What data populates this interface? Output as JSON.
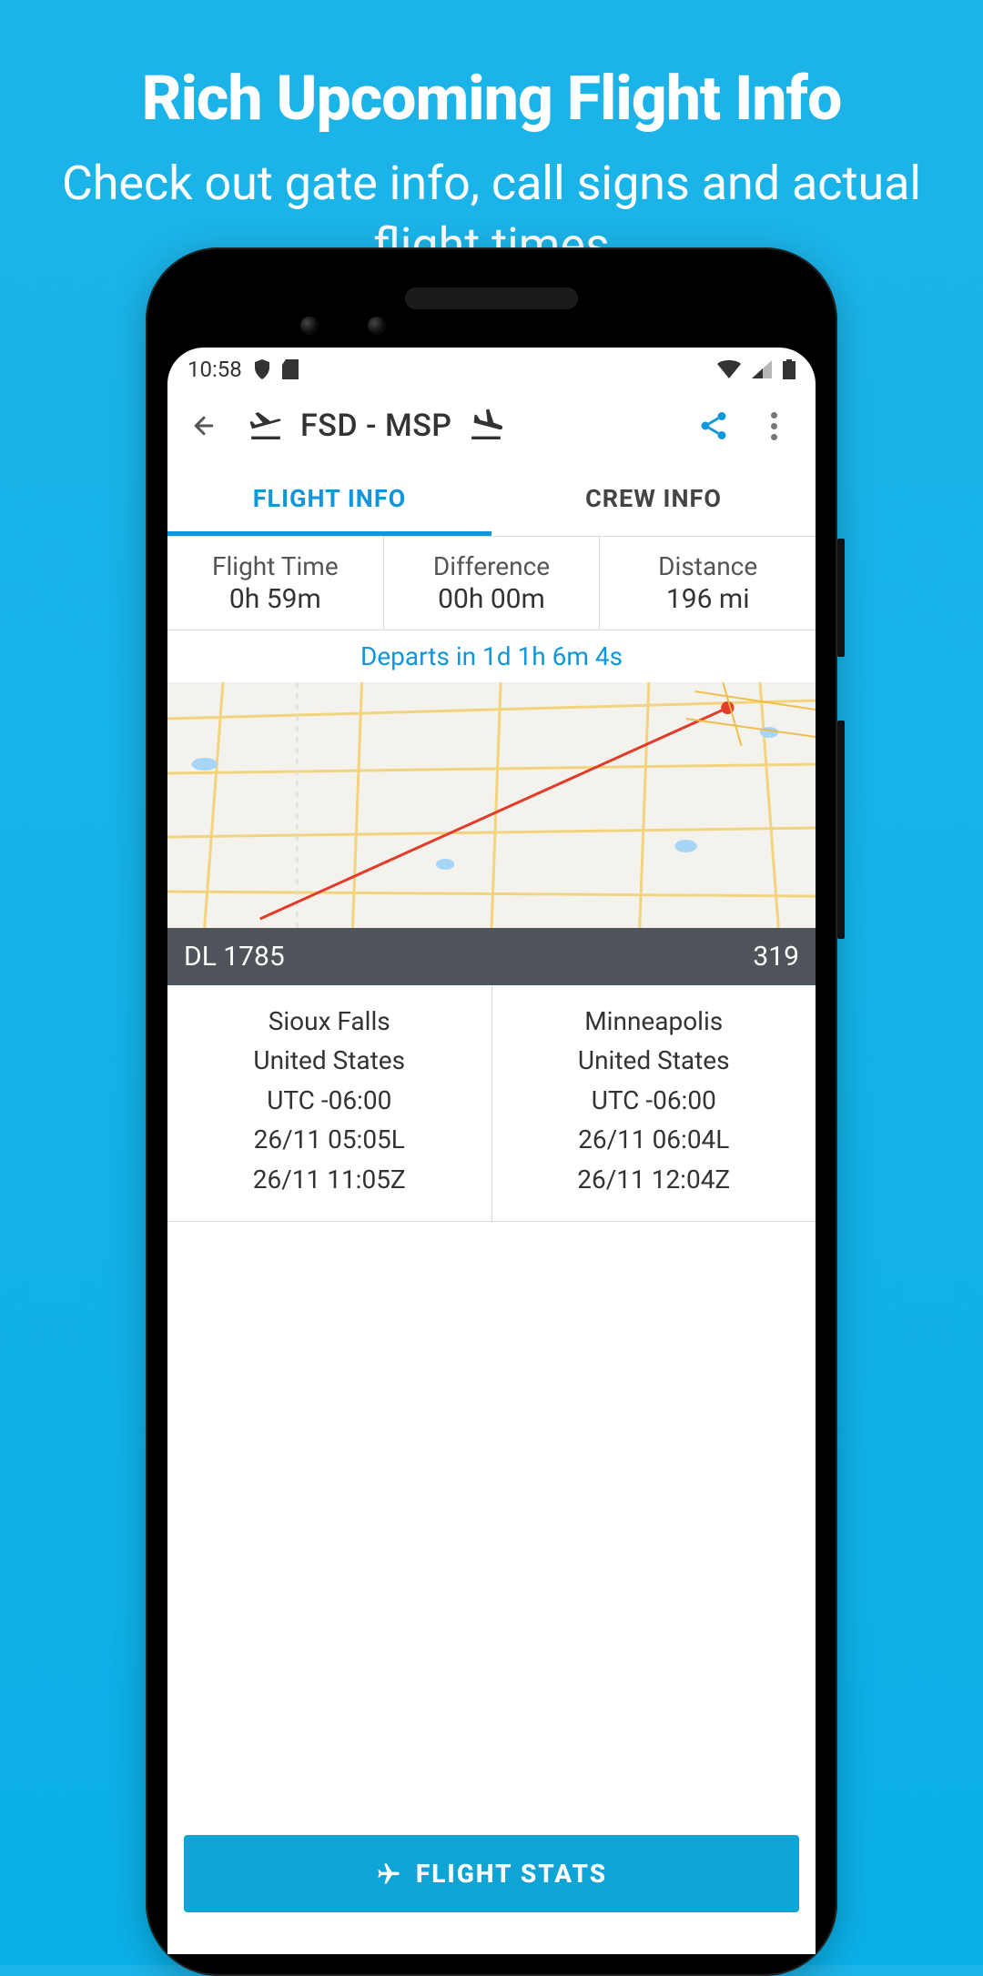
{
  "promo": {
    "title": "Rich Upcoming Flight Info",
    "subtitle": "Check out gate info, call signs and actual flight times"
  },
  "statusbar": {
    "time": "10:58"
  },
  "header": {
    "route": "FSD - MSP"
  },
  "tabs": {
    "flight_info": "FLIGHT INFO",
    "crew_info": "CREW INFO"
  },
  "stats": {
    "flight_time": {
      "label": "Flight Time",
      "value": "0h 59m"
    },
    "difference": {
      "label": "Difference",
      "value": "00h 00m"
    },
    "distance": {
      "label": "Distance",
      "value": "196 mi"
    }
  },
  "departs_in": "Departs in 1d 1h 6m 4s",
  "flight": {
    "callsign": "DL 1785",
    "aircraft": "319"
  },
  "origin": {
    "city": "Sioux Falls",
    "country": "United States",
    "tz": "UTC -06:00",
    "local": "26/11 05:05L",
    "zulu": "26/11 11:05Z"
  },
  "destination": {
    "city": "Minneapolis",
    "country": "United States",
    "tz": "UTC -06:00",
    "local": "26/11 06:04L",
    "zulu": "26/11 12:04Z"
  },
  "button": {
    "flight_stats": "FLIGHT STATS"
  }
}
